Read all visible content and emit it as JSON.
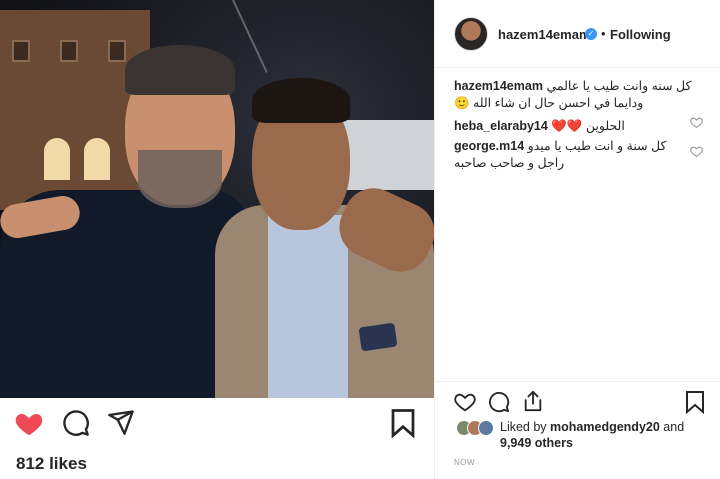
{
  "post": {
    "likes_text": "812 likes"
  },
  "panel": {
    "username": "hazem14emam",
    "follow_dot": "•",
    "follow_label": "Following",
    "comments": [
      {
        "user": "hazem14emam",
        "text": "كل سنه وانت طيب يا عالمي ودايما في احسن حال ان شاء الله 🙂"
      },
      {
        "user": "heba_elaraby14",
        "text": "الحلوين ❤️❤️"
      },
      {
        "user": "george.m14",
        "text": "كل سنة و انت طيب يا ميدو راجل و صاحب صاحبه"
      }
    ],
    "liked_by_prefix": "Liked by",
    "liked_by_user": "mohamedgendy20",
    "liked_by_and": "and",
    "liked_by_others": "9,949 others",
    "timestamp": "NOW"
  },
  "colors": {
    "like_red": "#ed4956",
    "verified_blue": "#3897f0",
    "text": "#262626",
    "muted": "#999999"
  },
  "icons": [
    "heart-filled-icon",
    "comment-icon",
    "share-icon",
    "bookmark-icon",
    "heart-outline-icon",
    "verified-badge-icon"
  ]
}
